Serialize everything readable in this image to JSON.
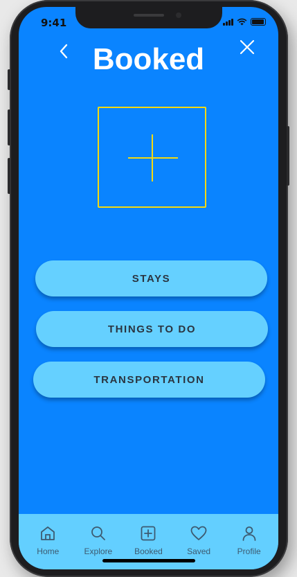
{
  "status_bar": {
    "time": "9:41"
  },
  "header": {
    "title": "Booked"
  },
  "add_box": {
    "icon": "plus-icon"
  },
  "options": [
    {
      "label": "STAYS"
    },
    {
      "label": "THINGS TO DO"
    },
    {
      "label": "TRANSPORTATION"
    }
  ],
  "tab_bar": {
    "items": [
      {
        "label": "Home",
        "icon": "home-icon"
      },
      {
        "label": "Explore",
        "icon": "search-icon"
      },
      {
        "label": "Booked",
        "icon": "plus-square-icon"
      },
      {
        "label": "Saved",
        "icon": "heart-icon"
      },
      {
        "label": "Profile",
        "icon": "person-icon"
      }
    ]
  },
  "colors": {
    "background": "#0a84ff",
    "accent_yellow": "#f5d90f",
    "button_fill": "#65d0ff",
    "tab_bar": "#63cfff",
    "tab_icon": "#3d5a70"
  }
}
